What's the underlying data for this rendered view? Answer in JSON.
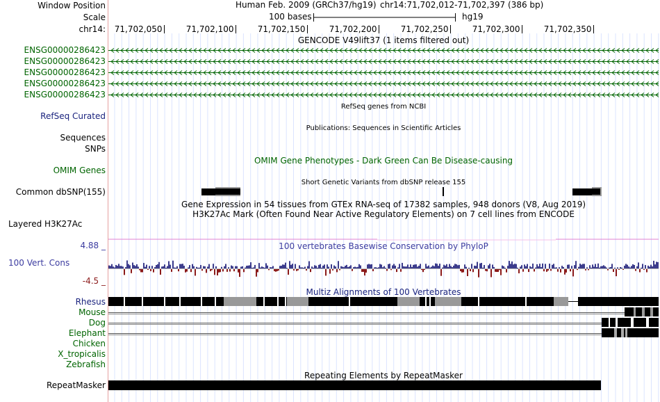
{
  "header": {
    "window_position_label": "Window Position",
    "scale_label": "Scale",
    "chrom_label": "chr14:",
    "assembly_text": "Human Feb. 2009 (GRCh37/hg19)",
    "position_text": "chr14:71,702,012-71,702,397 (386 bp)",
    "scale_text": "100 bases",
    "db_text": "hg19",
    "ruler_ticks": [
      "71,702,050",
      "71,702,100",
      "71,702,150",
      "71,702,200",
      "71,702,250",
      "71,702,300",
      "71,702,350"
    ]
  },
  "gencode": {
    "title": "GENCODE V49lift37 (1 items filtered out)",
    "items": [
      "ENSG00000286423",
      "ENSG00000286423",
      "ENSG00000286423",
      "ENSG00000286423",
      "ENSG00000286423"
    ],
    "color": "#006400"
  },
  "tracks": {
    "refseq_label": "RefSeq Curated",
    "refseq_title": "RefSeq genes from NCBI",
    "publications_title": "Publications: Sequences in Scientific Articles",
    "sequences_label": "Sequences",
    "snps_label": "SNPs",
    "omim_label": "OMIM Genes",
    "omim_title": "OMIM Gene Phenotypes - Dark Green Can Be Disease-causing",
    "dbsnp_label": "Common dbSNP(155)",
    "dbsnp_title": "Short Genetic Variants from dbSNP release 155",
    "gtex_title": "Gene Expression in 54 tissues from GTEx RNA-seq of 17382 samples, 948 donors (V8, Aug 2019)",
    "h3k27ac_title": "H3K27Ac Mark (Often Found Near Active Regulatory Elements) on 7 cell lines from ENCODE",
    "h3k27ac_label": "Layered H3K27Ac",
    "cons_max": "4.88 _",
    "cons_label": "100 Vert. Cons",
    "cons_min": "-4.5 _",
    "cons_title": "100 vertebrates Basewise Conservation by PhyloP",
    "multiz_title": "Multiz Alignments of 100 Vertebrates",
    "species": [
      "Rhesus",
      "Mouse",
      "Dog",
      "Elephant",
      "Chicken",
      "X_tropicalis",
      "Zebrafish"
    ],
    "repeat_title": "Repeating Elements by RepeatMasker",
    "repeat_label": "RepeatMasker"
  },
  "colors": {
    "gencode_green": "#006400",
    "conservation_pos": "#3c3c8c",
    "conservation_neg": "#8b1a1a",
    "h3k27ac_pink": "#e080d0",
    "separator_red": "#e6a0a0"
  }
}
